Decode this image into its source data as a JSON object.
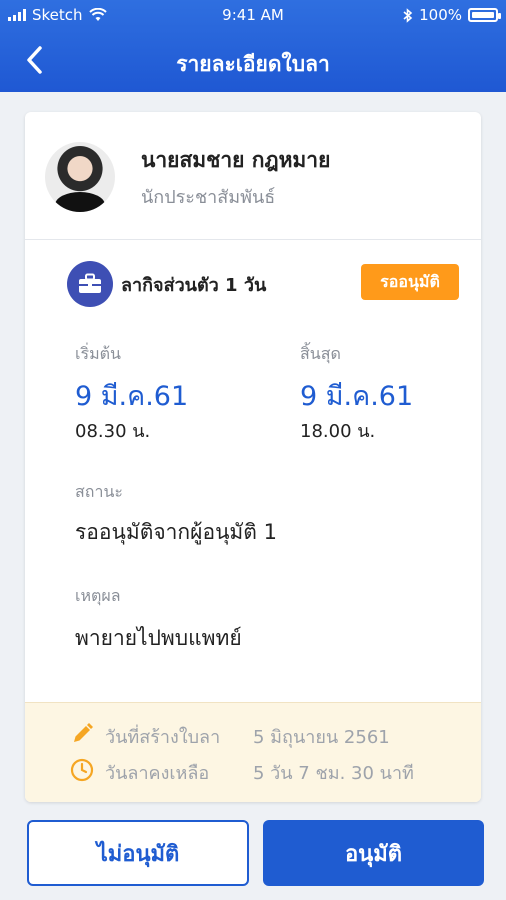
{
  "status_bar": {
    "carrier": "Sketch",
    "time": "9:41 AM",
    "battery": "100%"
  },
  "nav": {
    "title": "รายละเอียดใบลา"
  },
  "profile": {
    "name": "นายสมชาย กฎหมาย",
    "role": "นักประชาสัมพันธ์"
  },
  "leave": {
    "type": "ลากิจส่วนตัว 1 วัน",
    "badge": "รออนุมัติ",
    "start_label": "เริ่มต้น",
    "start_date": "9 มี.ค.61",
    "start_time": "08.30 น.",
    "end_label": "สิ้นสุด",
    "end_date": "9 มี.ค.61",
    "end_time": "18.00 น.",
    "status_label": "สถานะ",
    "status_value": "รออนุมัติจากผู้อนุมัติ 1",
    "reason_label": "เหตุผล",
    "reason_value": "พายายไปพบแพทย์"
  },
  "meta": {
    "created_label": "วันที่สร้างใบลา",
    "created_value": "5 มิถุนายน 2561",
    "remaining_label": "วันลาคงเหลือ",
    "remaining_value": "5 วัน  7 ชม. 30 นาที"
  },
  "actions": {
    "reject": "ไม่อนุมัติ",
    "approve": "อนุมัติ"
  },
  "colors": {
    "primary": "#1f5cd1",
    "badge": "#ff9a1a",
    "meta_bg": "#fdf6e3",
    "icon_orange": "#f5a623"
  }
}
